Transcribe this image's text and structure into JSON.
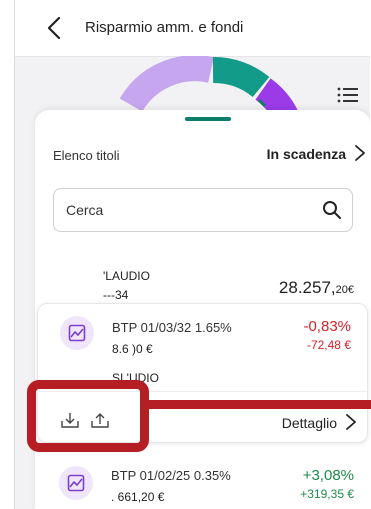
{
  "header": {
    "title": "Risparmio amm. e fondi"
  },
  "sheet": {
    "list_label": "Elenco titoli",
    "sort_label": "In scadenza",
    "search_placeholder": "Cerca",
    "account": {
      "owner": "'LAUDIO",
      "number": "---34",
      "total_main": "28.257,",
      "total_cents": "20€"
    },
    "bonds": [
      {
        "name": "BTP 01/03/32 1.65%",
        "value": "8.6      )0 €",
        "pct": "-0,83%",
        "amount": "-72,48 €",
        "trend": "negative",
        "owner_line": "SI            'UDIO"
      },
      {
        "name": "BTP 01/02/25 0.35%",
        "value": ".    661,20 €",
        "pct": "+3,08%",
        "amount": "+319,35 €",
        "trend": "positive"
      }
    ],
    "detail_label": "Dettaglio"
  },
  "colors": {
    "brand_green": "#0c7d68",
    "negative": "#d3202a",
    "positive": "#1d8a4a",
    "highlight": "#b51f24",
    "gauge_lilac": "#c6a6ee",
    "gauge_teal": "#129b88",
    "gauge_purple": "#9b3be8"
  },
  "icons": [
    "back-chevron-icon",
    "list-icon",
    "search-icon",
    "chevron-right-icon",
    "bond-chart-icon",
    "deposit-tray-icon",
    "withdraw-tray-icon"
  ]
}
